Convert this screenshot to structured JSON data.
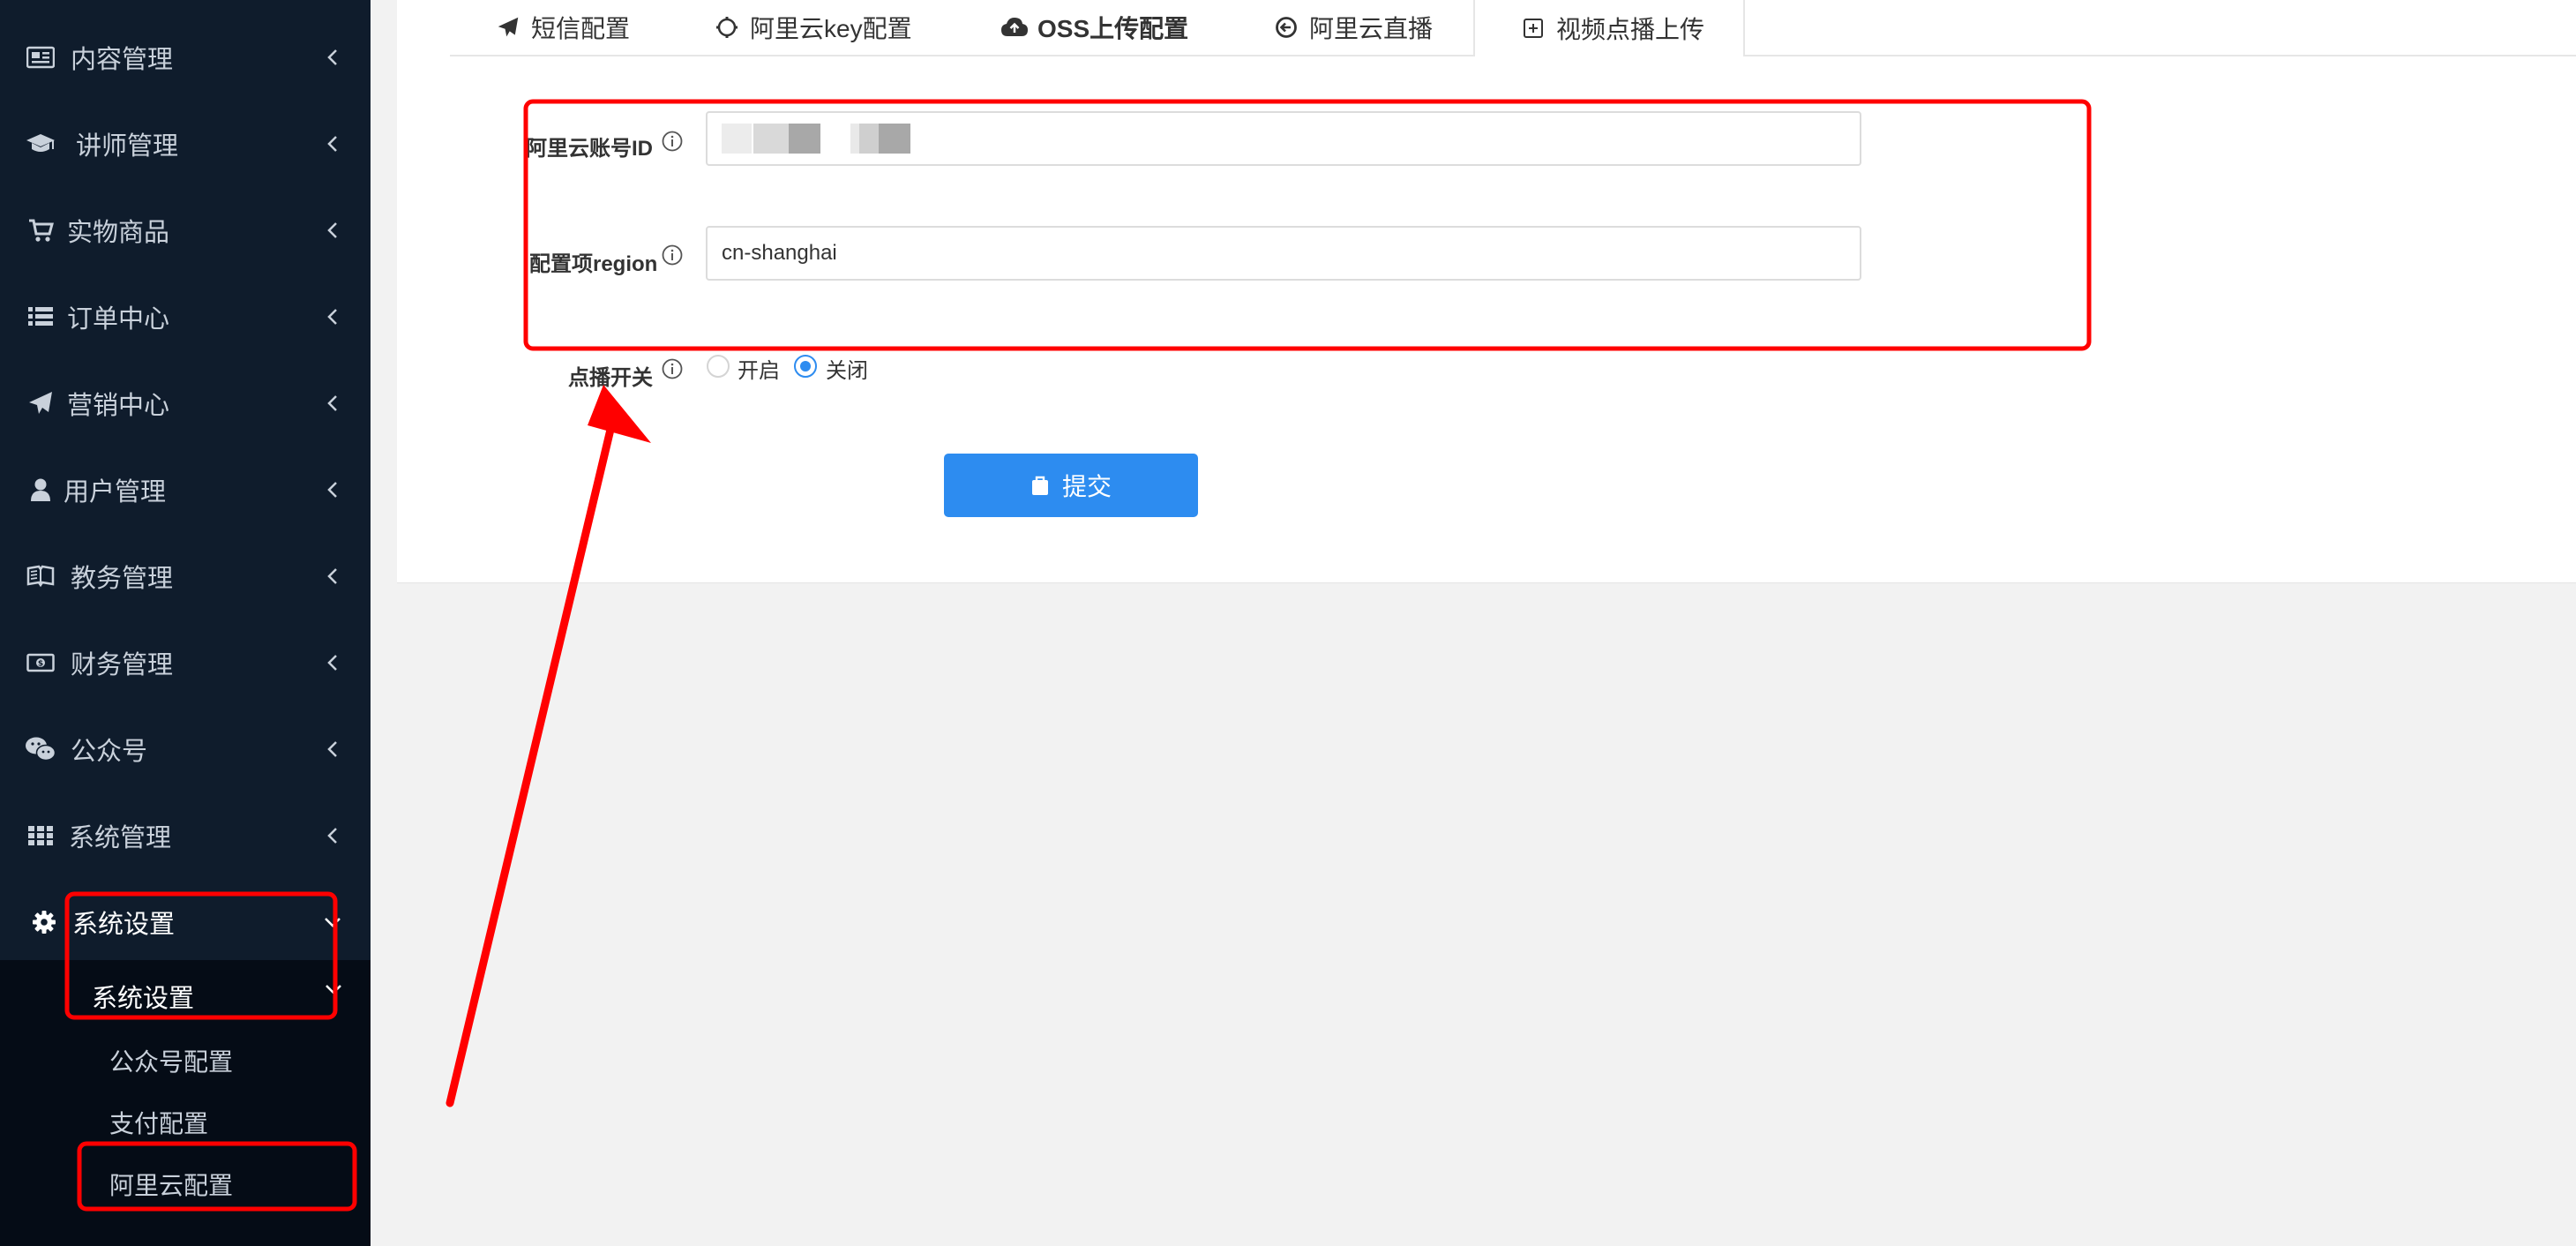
{
  "sidebar": {
    "items": [
      {
        "label": "内容管理",
        "icon": "newspaper-icon"
      },
      {
        "label": "讲师管理",
        "icon": "graduation-cap-icon"
      },
      {
        "label": "实物商品",
        "icon": "cart-icon"
      },
      {
        "label": "订单中心",
        "icon": "list-icon"
      },
      {
        "label": "营销中心",
        "icon": "paper-plane-icon"
      },
      {
        "label": "用户管理",
        "icon": "user-icon"
      },
      {
        "label": "教务管理",
        "icon": "book-icon"
      },
      {
        "label": "财务管理",
        "icon": "money-icon"
      },
      {
        "label": "公众号",
        "icon": "wechat-icon"
      },
      {
        "label": "系统管理",
        "icon": "grid-icon"
      },
      {
        "label": "系统设置",
        "icon": "gear-icon"
      }
    ],
    "submenu": {
      "title": "系统设置",
      "items": [
        "公众号配置",
        "支付配置",
        "阿里云配置"
      ]
    }
  },
  "tabs": [
    {
      "label": "短信配置",
      "icon": "paper-plane-icon"
    },
    {
      "label": "阿里云key配置",
      "icon": "gear-outline-icon"
    },
    {
      "label": "OSS上传配置",
      "icon": "cloud-upload-icon"
    },
    {
      "label": "阿里云直播",
      "icon": "circle-arrow-icon"
    },
    {
      "label": "视频点播上传",
      "icon": "plus-square-icon"
    }
  ],
  "active_tab": "视频点播上传",
  "form": {
    "account_id": {
      "label": "阿里云账号ID",
      "value": ""
    },
    "region": {
      "label": "配置项region",
      "value": "cn-shanghai"
    },
    "vod_switch": {
      "label": "点播开关",
      "options": [
        "开启",
        "关闭"
      ],
      "selected": "关闭"
    },
    "submit_label": "提交"
  },
  "colors": {
    "sidebar_bg": "#0f1c2c",
    "submenu_bg": "#050c16",
    "primary": "#2d8cf0",
    "annotation_red": "#ff0000"
  }
}
